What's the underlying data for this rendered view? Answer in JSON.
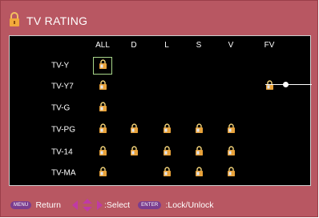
{
  "header": {
    "title": "TV RATING",
    "icon": "lock-icon"
  },
  "table": {
    "columns": [
      "ALL",
      "D",
      "L",
      "S",
      "V",
      "FV"
    ],
    "rows": [
      {
        "label": "TV-Y",
        "locks": [
          true,
          false,
          false,
          false,
          false,
          false
        ]
      },
      {
        "label": "TV-Y7",
        "locks": [
          true,
          false,
          false,
          false,
          false,
          true
        ]
      },
      {
        "label": "TV-G",
        "locks": [
          true,
          false,
          false,
          false,
          false,
          false
        ]
      },
      {
        "label": "TV-PG",
        "locks": [
          true,
          true,
          true,
          true,
          true,
          false
        ]
      },
      {
        "label": "TV-14",
        "locks": [
          true,
          true,
          true,
          true,
          true,
          false
        ]
      },
      {
        "label": "TV-MA",
        "locks": [
          true,
          false,
          true,
          true,
          true,
          false
        ]
      }
    ],
    "selected": {
      "row": 0,
      "col": 0
    }
  },
  "footer": {
    "menu_key": "MENU",
    "return_label": "Return",
    "select_label": ":Select",
    "enter_key": "ENTER",
    "lock_label": ":Lock/Unlock"
  },
  "colors": {
    "background": "#b85762",
    "panel": "#000000",
    "accent": "#f2a93b",
    "key": "#7b3d8f",
    "selection": "#a8d68a"
  }
}
